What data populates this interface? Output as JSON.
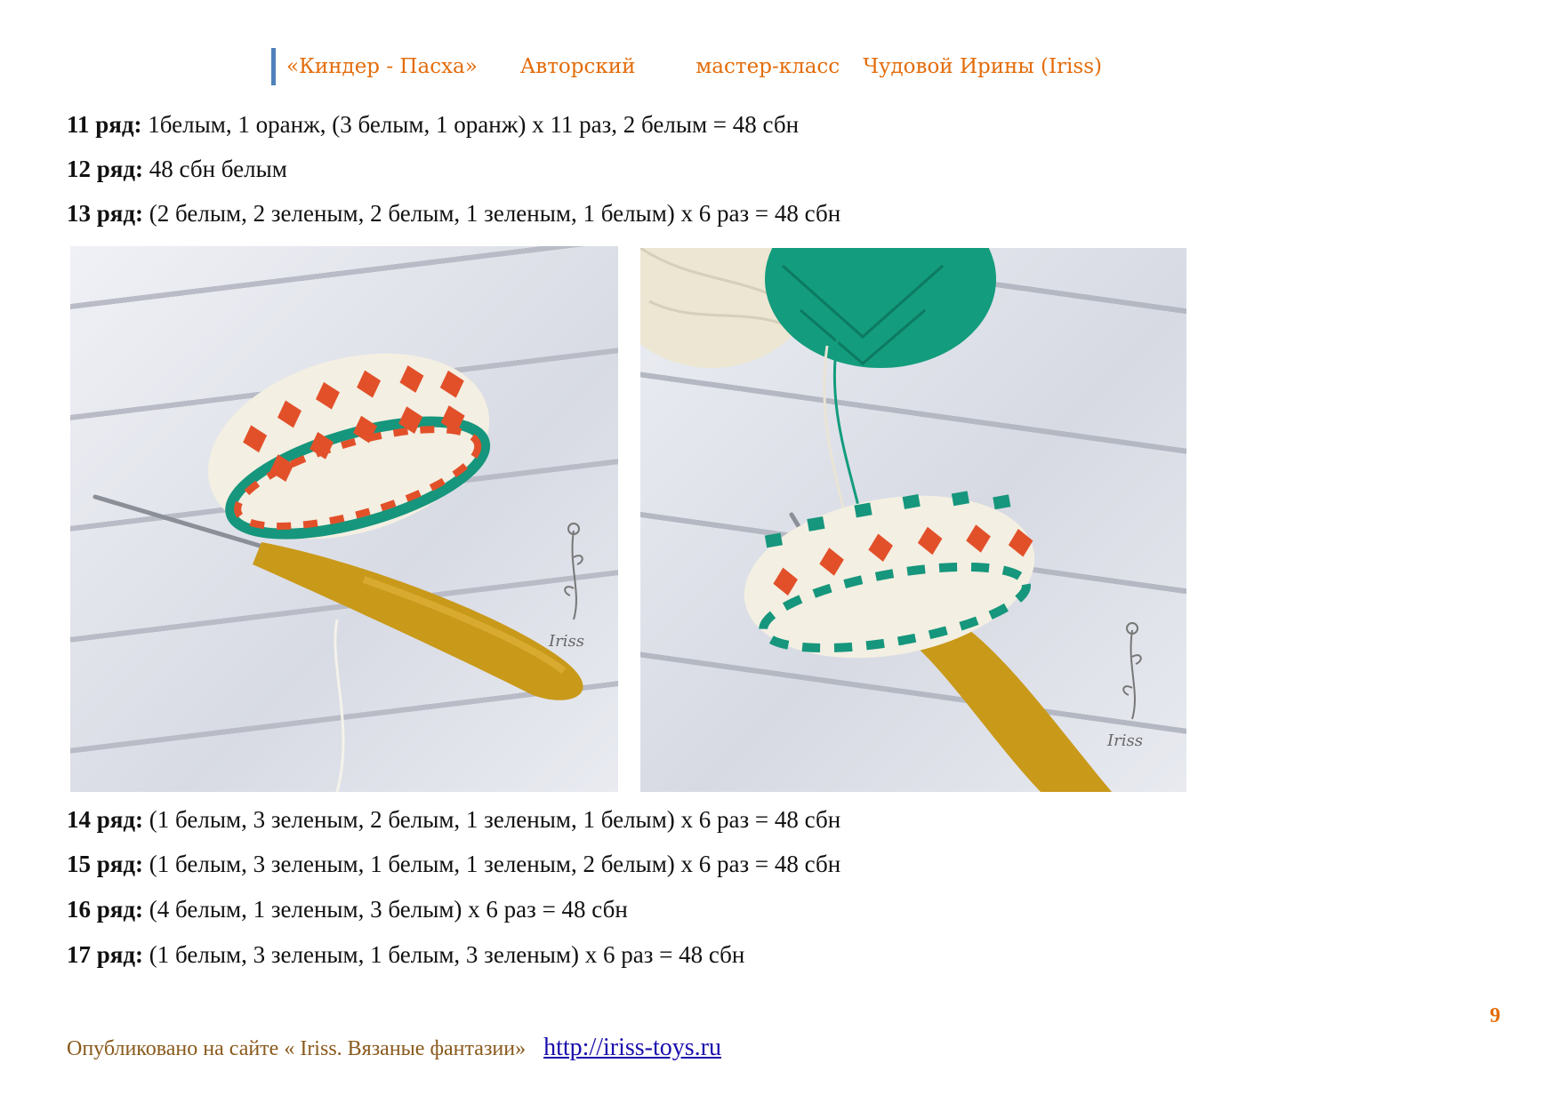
{
  "header": {
    "title": "«Киндер - Пасха»",
    "part1": "Авторский",
    "part2": "мастер-класс",
    "part3": "Чудовой Ирины (Iriss)"
  },
  "rows_top": [
    {
      "label": "11 ряд:",
      "text": " 1белым, 1 оранж, (3 белым, 1 оранж) х 11 раз, 2 белым = 48 сбн"
    },
    {
      "label": "12 ряд:",
      "text": " 48 сбн белым"
    },
    {
      "label": "13 ряд:",
      "text": " (2 белым, 2 зеленым, 2 белым, 1 зеленым, 1 белым) х 6 раз = 48 сбн"
    }
  ],
  "rows_bottom": [
    {
      "label": "14 ряд:",
      "text": " (1 белым, 3 зеленым, 2 белым, 1 зеленым, 1 белым) х 6 раз = 48 сбн"
    },
    {
      "label": "15 ряд:",
      "text": " (1 белым, 3 зеленым, 1 белым, 1 зеленым, 2 белым) х 6 раз = 48 сбн"
    },
    {
      "label": "16 ряд:",
      "text": " (4 белым, 1 зеленым, 3 белым) х 6 раз = 48 сбн"
    },
    {
      "label": "17 ряд:",
      "text": " (1 белым, 3 зеленым, 1 белым, 3 зеленым) х 6 раз = 48 сбн"
    }
  ],
  "watermark": "Iriss",
  "page_number": "9",
  "footer": {
    "text": "Опубликовано на сайте « Iriss. Вязаные фантазии»",
    "link": "http://iriss-toys.ru"
  },
  "colors": {
    "header_orange": "#e36c0a",
    "header_bar_blue": "#4f81bd",
    "yarn_orange": "#e2502a",
    "yarn_green": "#16967c",
    "hook_yellow": "#c9991a"
  }
}
